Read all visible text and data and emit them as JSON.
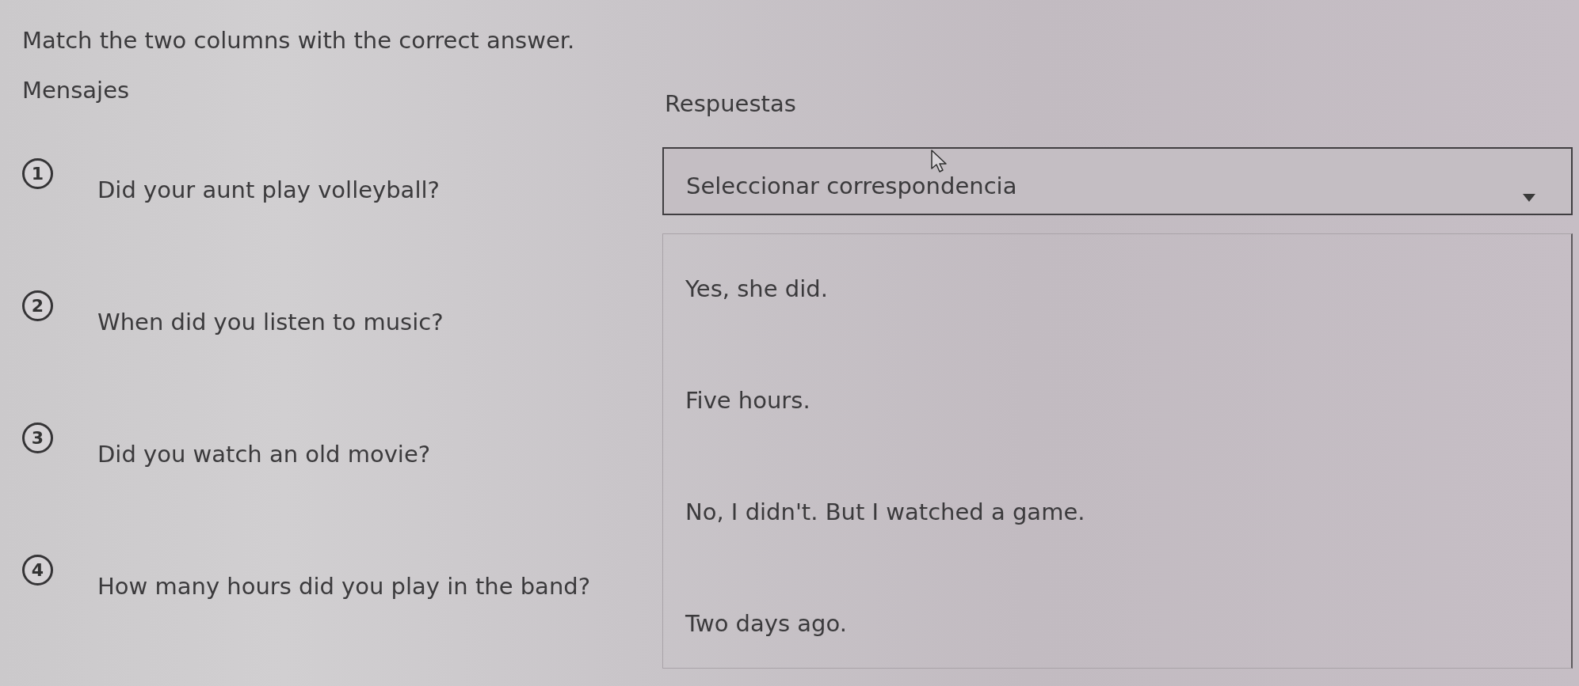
{
  "instruction": "Match the two columns with the correct answer.",
  "messages": {
    "heading": "Mensajes",
    "items": [
      {
        "number": "1",
        "text": "Did your aunt play volleyball?"
      },
      {
        "number": "2",
        "text": "When did you listen to music?"
      },
      {
        "number": "3",
        "text": "Did you watch an old movie?"
      },
      {
        "number": "4",
        "text": "How many hours did you play in the band?"
      }
    ]
  },
  "answers": {
    "heading": "Respuestas",
    "dropdown": {
      "placeholder": "Seleccionar correspondencia",
      "expanded": true
    },
    "options": [
      {
        "text": "Yes, she did.",
        "selected": false
      },
      {
        "text": "Five hours.",
        "selected": false
      },
      {
        "text": "No, I didn't. But I watched a game.",
        "selected": false
      },
      {
        "text": "Two days ago.",
        "selected": false
      }
    ]
  }
}
